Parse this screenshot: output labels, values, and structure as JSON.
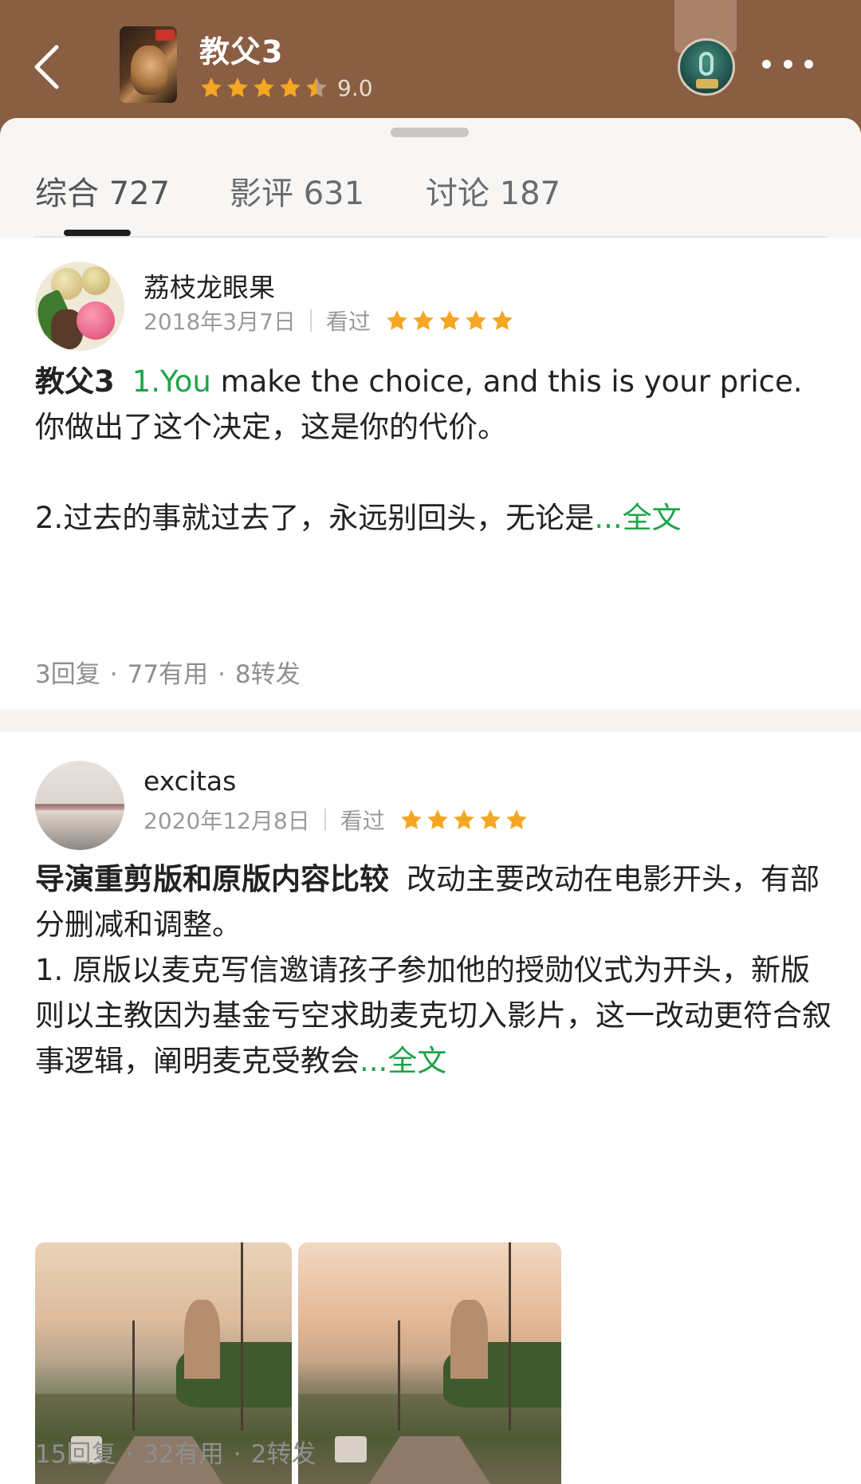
{
  "header": {
    "movie_title": "教父3",
    "rating_score": "9.0",
    "rating_stars": 4.5,
    "star_color": "#f5a623"
  },
  "tabs": [
    {
      "label": "综合 727",
      "active": true
    },
    {
      "label": "影评 631",
      "active": false
    },
    {
      "label": "讨论 187",
      "active": false
    }
  ],
  "reviews": [
    {
      "author": "荔枝龙眼果",
      "date": "2018年3月7日",
      "watched": "看过",
      "stars": 5,
      "title": "教父3",
      "body_green": "1.You",
      "body_line1": " make the choice, and this is your price.",
      "body_line2": "你做出了这个决定，这是你的代价。",
      "body_line3": "2.过去的事就过去了，永远别回头，无论是",
      "more": "...全文",
      "replies": "3回复",
      "useful": "77有用",
      "shares": "8转发"
    },
    {
      "author": "excitas",
      "date": "2020年12月8日",
      "watched": "看过",
      "stars": 5,
      "title": "导演重剪版和原版内容比较",
      "body_line1": "改动主要改动在电影开头，有部分删减和调整。",
      "body_line2": "1. 原版以麦克写信邀请孩子参加他的授勋仪式为开头，新版则以主教因为基金亏空求助麦克切入影片，这一改动更符合叙事逻辑，阐明麦克受教会",
      "more": "...全文",
      "replies": "15回复",
      "useful": "32有用",
      "shares": "2转发"
    }
  ],
  "colors": {
    "header_bg": "#8a5e42",
    "accent_green": "#20a34a",
    "star": "#f5a623"
  }
}
